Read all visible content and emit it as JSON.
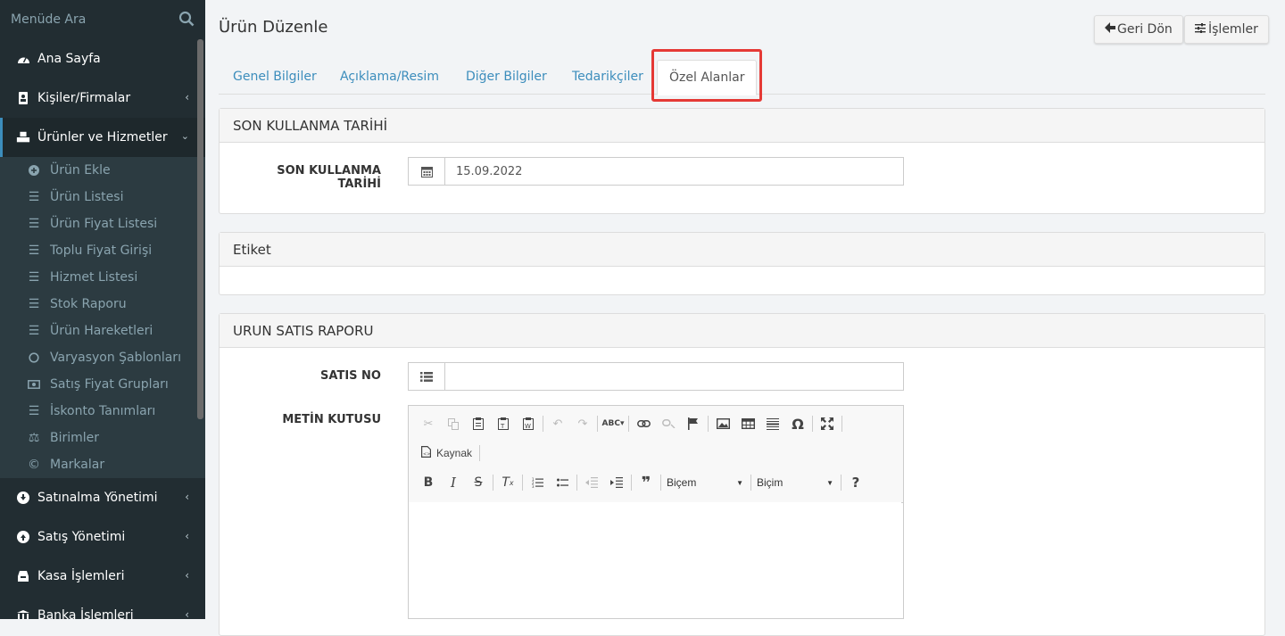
{
  "sidebar": {
    "search_placeholder": "Menüde Ara",
    "items": [
      {
        "label": "Ana Sayfa",
        "icon": "dashboard-icon"
      },
      {
        "label": "Kişiler/Firmalar",
        "icon": "address-book-icon"
      },
      {
        "label": "Ürünler ve Hizmetler",
        "icon": "cubes-icon"
      },
      {
        "label": "Satınalma Yönetimi",
        "icon": "arrow-circle-down-icon"
      },
      {
        "label": "Satış Yönetimi",
        "icon": "arrow-circle-up-icon"
      },
      {
        "label": "Kasa İşlemleri",
        "icon": "inbox-icon"
      },
      {
        "label": "Banka İşlemleri",
        "icon": "bank-icon"
      }
    ],
    "submenu": [
      {
        "label": "Ürün Ekle",
        "icon": "plus-circle-icon"
      },
      {
        "label": "Ürün Listesi",
        "icon": "list-icon"
      },
      {
        "label": "Ürün Fiyat Listesi",
        "icon": "list-icon"
      },
      {
        "label": "Toplu Fiyat Girişi",
        "icon": "list-icon"
      },
      {
        "label": "Hizmet Listesi",
        "icon": "list-icon"
      },
      {
        "label": "Stok Raporu",
        "icon": "list-icon"
      },
      {
        "label": "Ürün Hareketleri",
        "icon": "list-icon"
      },
      {
        "label": "Varyasyon Şablonları",
        "icon": "circle-icon"
      },
      {
        "label": "Satış Fiyat Grupları",
        "icon": "money-icon"
      },
      {
        "label": "İskonto Tanımları",
        "icon": "list-icon"
      },
      {
        "label": "Birimler",
        "icon": "balance-scale-icon"
      },
      {
        "label": "Markalar",
        "icon": "copyright-icon"
      }
    ]
  },
  "header": {
    "title": "Ürün Düzenle",
    "back_label": "Geri Dön",
    "actions_label": "İşlemler"
  },
  "tabs": [
    "Genel Bilgiler",
    "Açıklama/Resim",
    "Diğer Bilgiler",
    "Tedarikçiler",
    "Özel Alanlar"
  ],
  "panels": {
    "expiry": {
      "title": "SON KULLANMA TARİHİ",
      "label": "SON KULLANMA TARİHİ",
      "value": "15.09.2022"
    },
    "tag": {
      "title": "Etiket"
    },
    "report": {
      "title": "URUN SATIS RAPORU",
      "sale_no_label": "SATIS NO",
      "textbox_label": "METİN KUTUSU"
    }
  },
  "editor": {
    "source_label": "Kaynak",
    "format1": "Biçem",
    "format2": "Biçim"
  },
  "colors": {
    "sidebar_bg": "#222d32",
    "link": "#3c8dbc",
    "highlight": "#e53935"
  }
}
